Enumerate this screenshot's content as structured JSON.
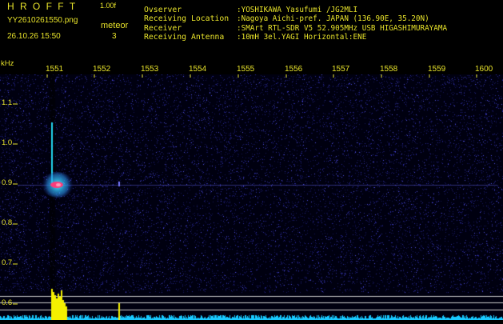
{
  "header": {
    "app_title": "HROFFT",
    "app_version": "1.00f",
    "file_name": "YY2610261550.png",
    "mode_label": "meteor",
    "timestamp": "26.10.26 15:50",
    "mode_count": "3",
    "info": [
      {
        "label": "Ovserver",
        "value": ":YOSHIKAWA Yasufumi /JG2MLI"
      },
      {
        "label": "Receiving Location",
        "value": ":Nagoya Aichi-pref. JAPAN (136.90E, 35.20N)"
      },
      {
        "label": "Receiver",
        "value": ":SMArt RTL-SDR V5 52.905MHz USB HIGASHIMURAYAMA"
      },
      {
        "label": "Receiving Antenna",
        "value": ":10mH 3el.YAGI Horizontal:ENE"
      }
    ]
  },
  "axes": {
    "unit": "kHz",
    "time_ticks": [
      "1551",
      "1552",
      "1553",
      "1554",
      "1555",
      "1556",
      "1557",
      "1558",
      "1559",
      "1600"
    ],
    "freq_ticks": [
      "1.1",
      "1.0",
      "0.9",
      "0.8",
      "0.7",
      "0.6"
    ]
  },
  "colors": {
    "label": "#e7e22a",
    "background": "#000000",
    "signal_core": "#ff3a7a",
    "signal_glow": "#22d4f0",
    "noise_dots": "#3a3ac8",
    "level_trace": "#19c9ff",
    "level_bar": "#f4f000",
    "ref_lines": "#c9c9c9"
  }
}
